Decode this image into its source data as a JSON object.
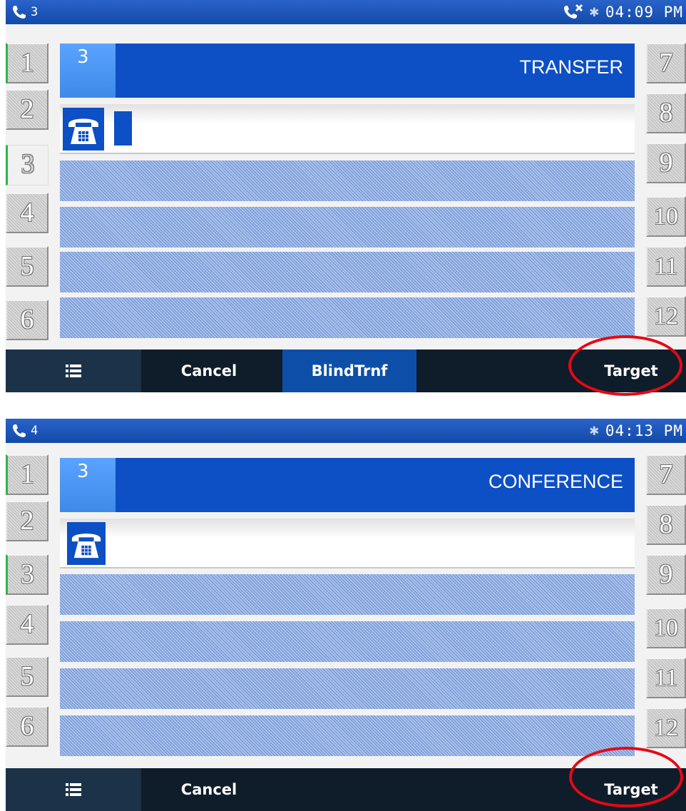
{
  "screens": [
    {
      "status": {
        "line_count": "3",
        "time": "04:09 PM"
      },
      "left_keys": [
        "1",
        "2",
        "3",
        "4",
        "5",
        "6"
      ],
      "right_keys": [
        "7",
        "8",
        "9",
        "10",
        "11",
        "12"
      ],
      "call": {
        "line": "3",
        "mode": "TRANSFER"
      },
      "softkeys": {
        "cancel": "Cancel",
        "blind_transfer": "BlindTrnf",
        "target": "Target"
      }
    },
    {
      "status": {
        "line_count": "4",
        "time": "04:13 PM"
      },
      "left_keys": [
        "1",
        "2",
        "3",
        "4",
        "5",
        "6"
      ],
      "right_keys": [
        "7",
        "8",
        "9",
        "10",
        "11",
        "12"
      ],
      "call": {
        "line": "3",
        "mode": "CONFERENCE"
      },
      "softkeys": {
        "cancel": "Cancel",
        "target": "Target"
      }
    }
  ],
  "colors": {
    "accent_blue": "#0d4fc4",
    "status_bar": "#1a56b8",
    "active_line": "#2fb34a",
    "annotation": "#e50914"
  }
}
